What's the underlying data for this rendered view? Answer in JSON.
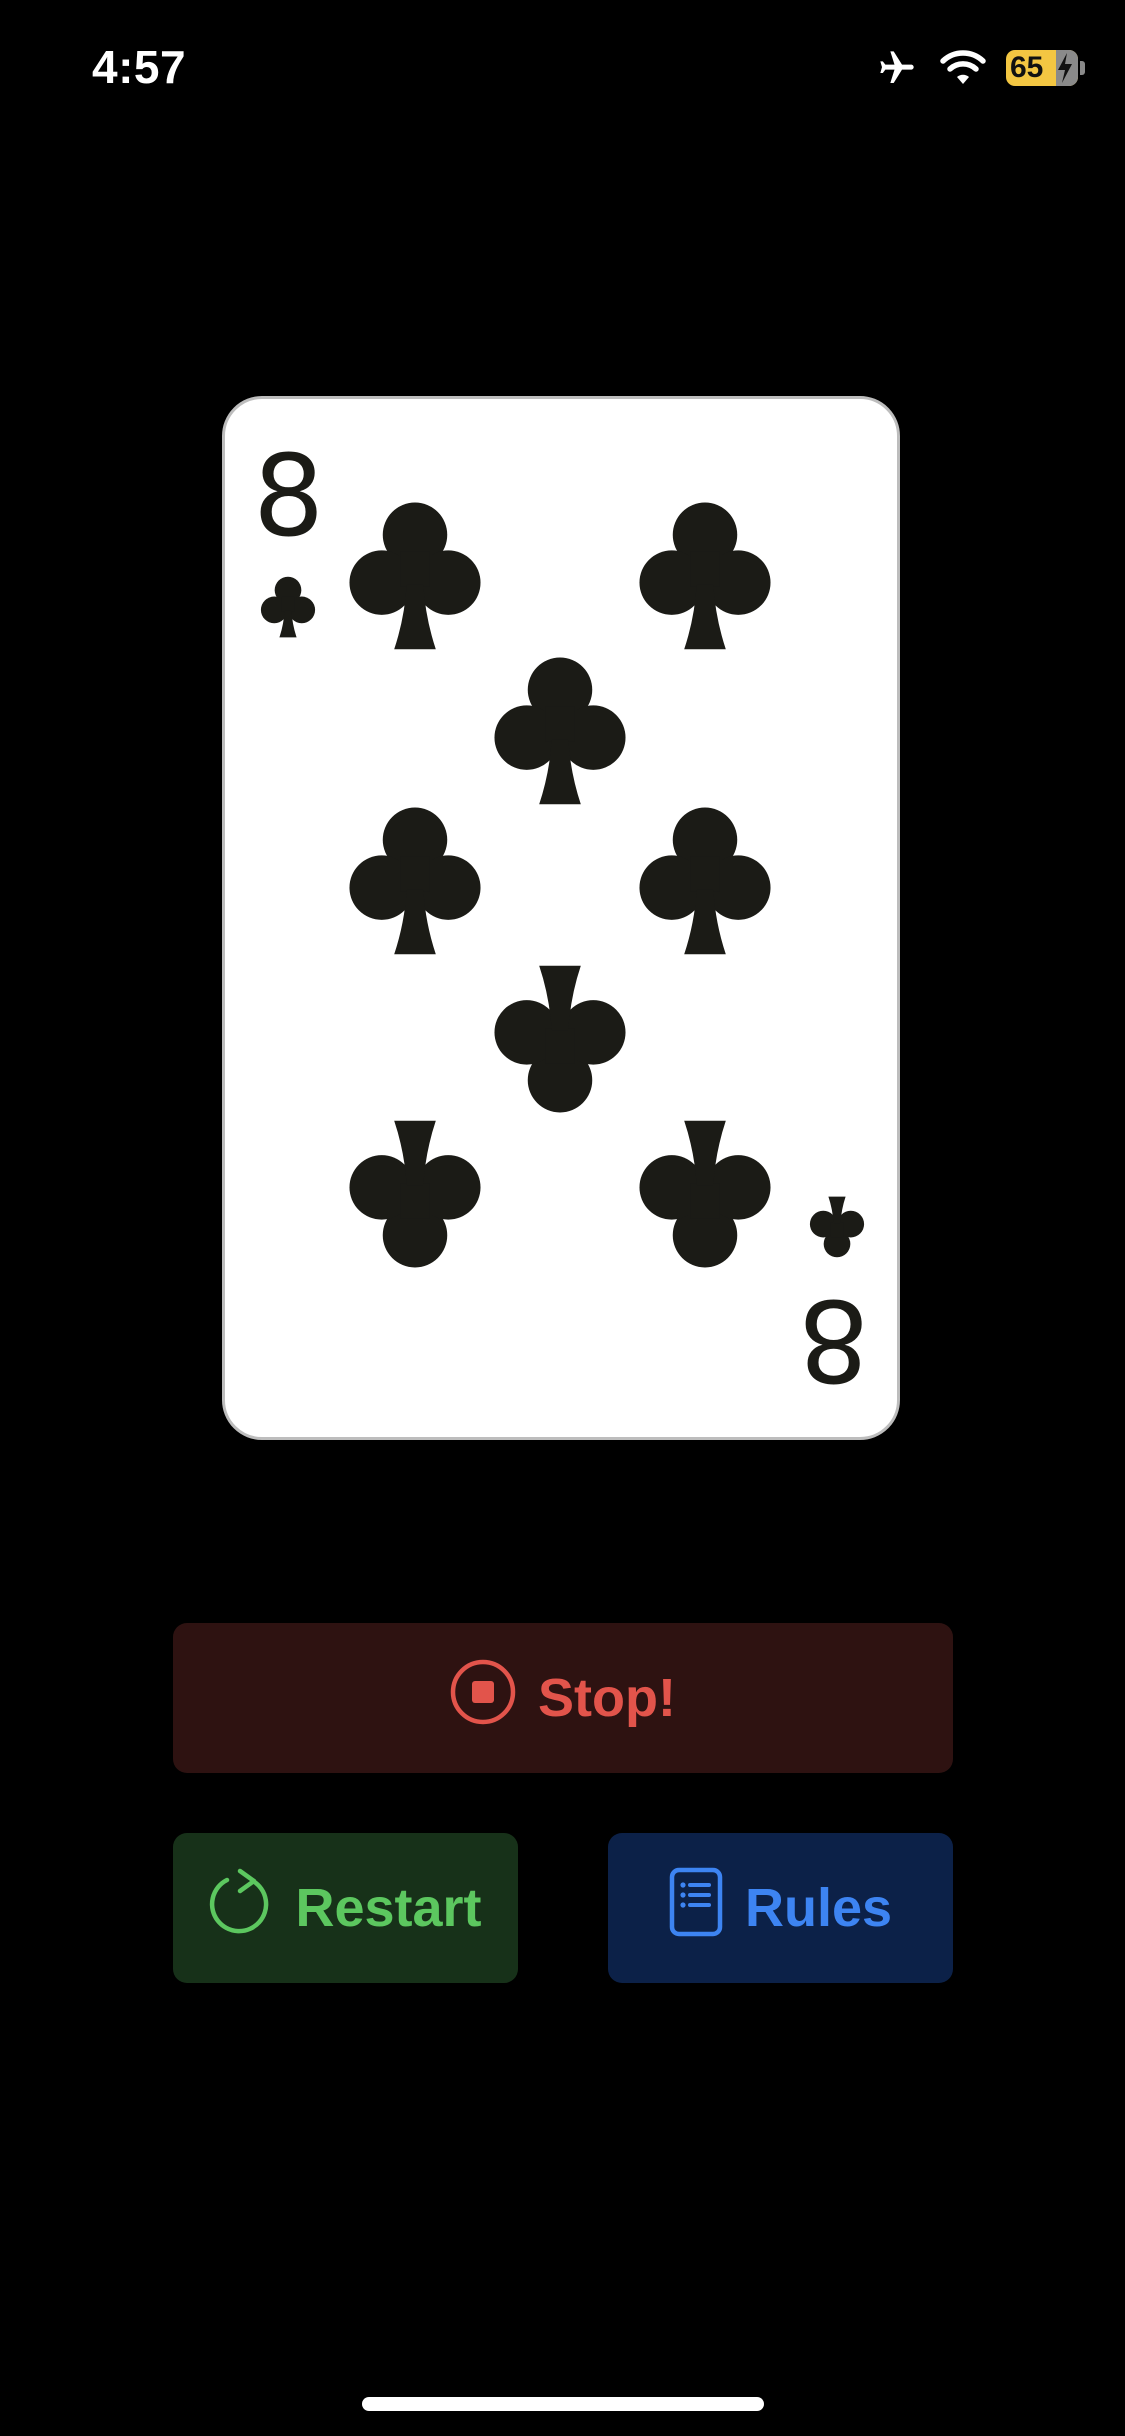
{
  "status_bar": {
    "time": "4:57",
    "battery_level": "65",
    "icons": [
      "airplane-icon",
      "wifi-icon",
      "battery-charging-icon"
    ]
  },
  "card": {
    "rank": "8",
    "suit": "clubs",
    "suit_icon": "club-icon",
    "colors": {
      "face": "#ffffff",
      "ink": "#1b1b16",
      "border": "#bdbdbd"
    }
  },
  "buttons": {
    "stop": {
      "label": "Stop!",
      "icon": "stop-circle-icon",
      "color": "#e2544b",
      "background": "#2e1211"
    },
    "restart": {
      "label": "Restart",
      "icon": "restart-arrow-icon",
      "color": "#5cc75f",
      "background": "#173119"
    },
    "rules": {
      "label": "Rules",
      "icon": "rules-document-icon",
      "color": "#3d84f2",
      "background": "#0c2148"
    }
  }
}
